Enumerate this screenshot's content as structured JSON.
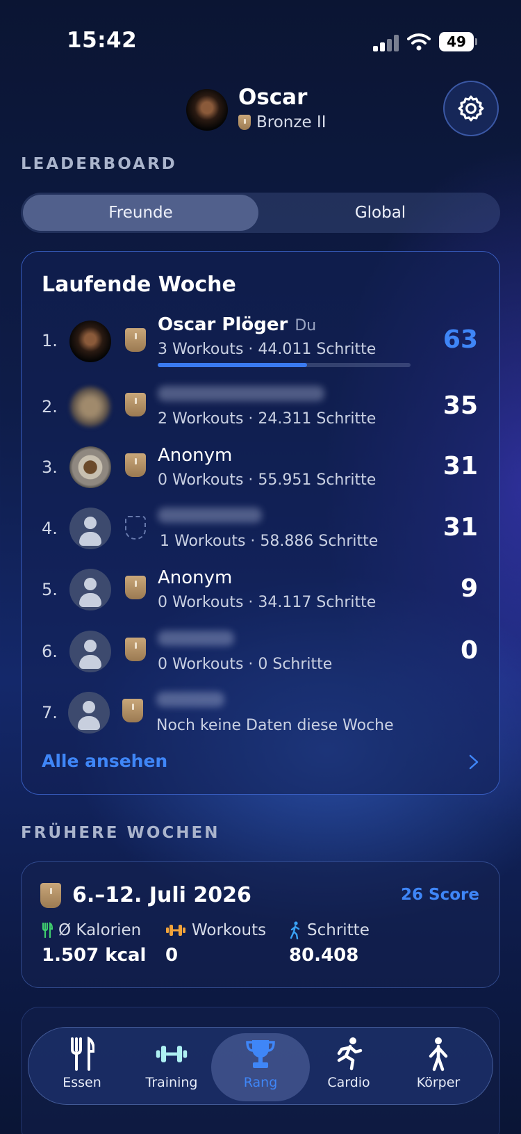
{
  "status_bar": {
    "time": "15:42",
    "battery": "49"
  },
  "header": {
    "name": "Oscar",
    "rank": "Bronze II"
  },
  "leaderboard": {
    "section_title": "LEADERBOARD",
    "tabs": [
      "Freunde",
      "Global"
    ],
    "active_tab": "Freunde",
    "card_title": "Laufende Woche",
    "you_label": "Du",
    "entries": [
      {
        "rank": "1.",
        "name": "Oscar Plöger",
        "stats": "3 Workouts · 44.011 Schritte",
        "score": "63",
        "progress": 0.59
      },
      {
        "rank": "2.",
        "name": "",
        "stats": "2 Workouts · 24.311 Schritte",
        "score": "35"
      },
      {
        "rank": "3.",
        "name": "Anonym",
        "stats": "0 Workouts · 55.951 Schritte",
        "score": "31"
      },
      {
        "rank": "4.",
        "name": "",
        "stats": "1 Workouts · 58.886 Schritte",
        "score": "31"
      },
      {
        "rank": "5.",
        "name": "Anonym",
        "stats": "0 Workouts · 34.117 Schritte",
        "score": "9"
      },
      {
        "rank": "6.",
        "name": "",
        "stats": "0 Workouts · 0 Schritte",
        "score": "0"
      },
      {
        "rank": "7.",
        "name": "",
        "stats": "Noch keine Daten diese Woche",
        "score": ""
      }
    ],
    "see_all": "Alle ansehen"
  },
  "previous_weeks": {
    "section_title": "FRÜHERE WOCHEN",
    "weeks": [
      {
        "date_range": "6.–12. Juli 2026",
        "score": "26 Score",
        "stats": [
          {
            "label": "Ø Kalorien",
            "value": "1.507 kcal"
          },
          {
            "label": "Workouts",
            "value": "0"
          },
          {
            "label": "Schritte",
            "value": "80.408"
          }
        ]
      }
    ]
  },
  "tab_bar": {
    "items": [
      "Essen",
      "Training",
      "Rang",
      "Cardio",
      "Körper"
    ],
    "active": "Rang"
  },
  "colors": {
    "accent": "#3f86f7",
    "bronze": "#b8956a"
  }
}
